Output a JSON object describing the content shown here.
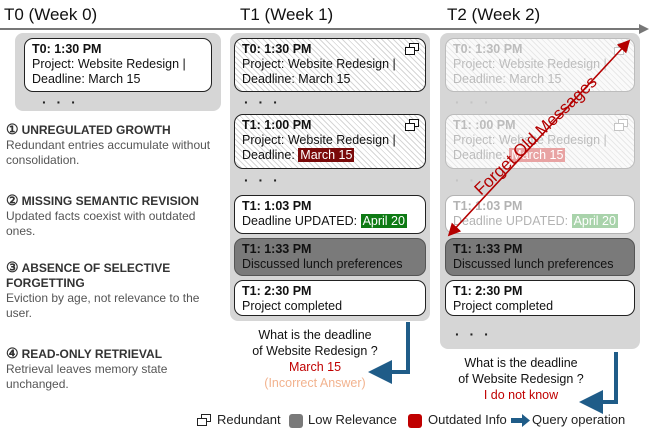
{
  "columns": [
    {
      "title": "T0 (Week 0)"
    },
    {
      "title": "T1 (Week 1)"
    },
    {
      "title": "T2 (Week 2)"
    }
  ],
  "t0": {
    "card": {
      "time": "T0: 1:30 PM",
      "line1": "Project: Website Redesign |",
      "line2": "Deadline: March 15"
    },
    "dots": "· · ·"
  },
  "issues": [
    {
      "num": "①",
      "heading": "UNREGULATED GROWTH",
      "text": "Redundant entries accumulate without consolidation."
    },
    {
      "num": "②",
      "heading": "MISSING SEMANTIC REVISION",
      "text": "Updated facts coexist with outdated ones."
    },
    {
      "num": "③",
      "heading": "ABSENCE OF SELECTIVE FORGETTING",
      "text": "Eviction by age, not relevance to the user."
    },
    {
      "num": "④",
      "heading": "READ-ONLY RETRIEVAL",
      "text": "Retrieval leaves memory state unchanged."
    }
  ],
  "t1": {
    "card1": {
      "time": "T0: 1:30 PM",
      "line1": "Project: Website Redesign |",
      "line2": "Deadline: March 15"
    },
    "card2": {
      "time": "T1: 1:00 PM",
      "line1": "Project: Website Redesign |",
      "line2_prefix": "Deadline: ",
      "line2_highlight": "March 15"
    },
    "card3": {
      "time": "T1: 1:03 PM",
      "line_prefix": "Deadline UPDATED: ",
      "line_highlight": "April 20"
    },
    "card4": {
      "time": "T1: 1:33 PM",
      "line": "Discussed lunch preferences"
    },
    "card5": {
      "time": "T1: 2:30 PM",
      "line": "Project completed"
    },
    "dots": "· · ·",
    "question_l1": "What is the deadline",
    "question_l2": "of Website Redesign ?",
    "answer": "March 15",
    "answer_note": "(Incorrect Answer)"
  },
  "t2": {
    "card1": {
      "time": "T0: 1:30 PM",
      "line1": "Project: Website Redesign |",
      "line2": "Deadline: March 15"
    },
    "card2": {
      "time": "T1: :00 PM",
      "line1": "Project: Website Redesign |",
      "line2_prefix": "Deadline: ",
      "line2_highlight": "March 15"
    },
    "card3": {
      "time": "T1: 1:03 PM",
      "line_prefix": "Deadline UPDATED: ",
      "line_highlight": "April 20"
    },
    "card4": {
      "time": "T1: 1:33 PM",
      "line": "Discussed lunch preferences"
    },
    "card5": {
      "time": "T1: 2:30 PM",
      "line": "Project completed"
    },
    "dots": "· · ·",
    "forget_label": "Forget Old Messages",
    "question_l1": "What is the deadline",
    "question_l2": "of Website Redesign ?",
    "answer": "I do not know"
  },
  "legend": {
    "redundant": "Redundant",
    "low_relevance": "Low Relevance",
    "outdated": "Outdated Info",
    "query": "Query operation"
  },
  "colors": {
    "outdated": "#c00000",
    "updated": "#0e7a14",
    "low_relevance": "#7a7a7a",
    "arrow": "#1f5c88"
  }
}
